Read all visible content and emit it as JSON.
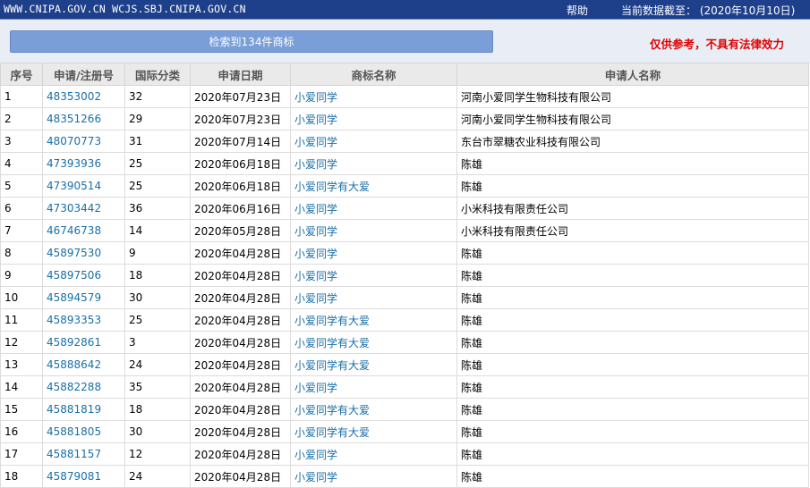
{
  "header": {
    "site_text": "WWW.CNIPA.GOV.CN WCJS.SBJ.CNIPA.GOV.CN",
    "help_label": "帮助",
    "data_date": "当前数据截至： (2020年10月10日)"
  },
  "search": {
    "result_label": "检索到134件商标",
    "disclaimer": "仅供参考，不具有法律效力"
  },
  "table": {
    "columns": [
      "序号",
      "申请/注册号",
      "国际分类",
      "申请日期",
      "商标名称",
      "申请人名称"
    ],
    "rows": [
      [
        "1",
        "48353002",
        "32",
        "2020年07月23日",
        "小爱同学",
        "河南小爱同学生物科技有限公司"
      ],
      [
        "2",
        "48351266",
        "29",
        "2020年07月23日",
        "小爱同学",
        "河南小爱同学生物科技有限公司"
      ],
      [
        "3",
        "48070773",
        "31",
        "2020年07月14日",
        "小爱同学",
        "东台市翠糖农业科技有限公司"
      ],
      [
        "4",
        "47393936",
        "25",
        "2020年06月18日",
        "小爱同学",
        "陈雄"
      ],
      [
        "5",
        "47390514",
        "25",
        "2020年06月18日",
        "小爱同学有大爱",
        "陈雄"
      ],
      [
        "6",
        "47303442",
        "36",
        "2020年06月16日",
        "小爱同学",
        "小米科技有限责任公司"
      ],
      [
        "7",
        "46746738",
        "14",
        "2020年05月28日",
        "小爱同学",
        "小米科技有限责任公司"
      ],
      [
        "8",
        "45897530",
        "9",
        "2020年04月28日",
        "小爱同学",
        "陈雄"
      ],
      [
        "9",
        "45897506",
        "18",
        "2020年04月28日",
        "小爱同学",
        "陈雄"
      ],
      [
        "10",
        "45894579",
        "30",
        "2020年04月28日",
        "小爱同学",
        "陈雄"
      ],
      [
        "11",
        "45893353",
        "25",
        "2020年04月28日",
        "小爱同学有大爱",
        "陈雄"
      ],
      [
        "12",
        "45892861",
        "3",
        "2020年04月28日",
        "小爱同学有大爱",
        "陈雄"
      ],
      [
        "13",
        "45888642",
        "24",
        "2020年04月28日",
        "小爱同学有大爱",
        "陈雄"
      ],
      [
        "14",
        "45882288",
        "35",
        "2020年04月28日",
        "小爱同学",
        "陈雄"
      ],
      [
        "15",
        "45881819",
        "18",
        "2020年04月28日",
        "小爱同学有大爱",
        "陈雄"
      ],
      [
        "16",
        "45881805",
        "30",
        "2020年04月28日",
        "小爱同学有大爱",
        "陈雄"
      ],
      [
        "17",
        "45881157",
        "12",
        "2020年04月28日",
        "小爱同学",
        "陈雄"
      ],
      [
        "18",
        "45879081",
        "24",
        "2020年04月28日",
        "小爱同学",
        "陈雄"
      ]
    ]
  }
}
